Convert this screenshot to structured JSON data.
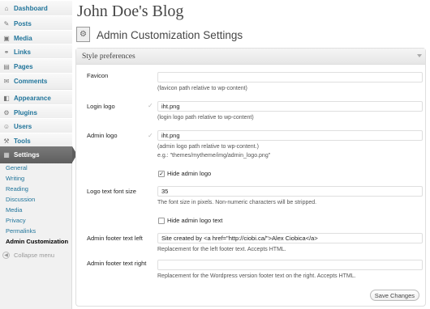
{
  "sidebar": {
    "items": [
      {
        "label": "Dashboard",
        "icon": "dashboard-icon",
        "glyph": "⌂"
      },
      {
        "label": "Posts",
        "icon": "posts-icon",
        "glyph": "✎"
      },
      {
        "label": "Media",
        "icon": "media-icon",
        "glyph": "▣"
      },
      {
        "label": "Links",
        "icon": "links-icon",
        "glyph": "⚭"
      },
      {
        "label": "Pages",
        "icon": "pages-icon",
        "glyph": "▤"
      },
      {
        "label": "Comments",
        "icon": "comments-icon",
        "glyph": "✉"
      },
      {
        "label": "Appearance",
        "icon": "appearance-icon",
        "glyph": "◧"
      },
      {
        "label": "Plugins",
        "icon": "plugins-icon",
        "glyph": "⚙"
      },
      {
        "label": "Users",
        "icon": "users-icon",
        "glyph": "☺"
      },
      {
        "label": "Tools",
        "icon": "tools-icon",
        "glyph": "⚒"
      },
      {
        "label": "Settings",
        "icon": "settings-icon",
        "glyph": "▦"
      }
    ],
    "submenu": [
      "General",
      "Writing",
      "Reading",
      "Discussion",
      "Media",
      "Privacy",
      "Permalinks",
      "Admin Customization"
    ],
    "collapse_label": "Collapse menu"
  },
  "header": {
    "blog_title": "John Doe's Blog",
    "page_title": "Admin Customization Settings"
  },
  "panel": {
    "title": "Style preferences",
    "favicon": {
      "label": "Favicon",
      "value": "",
      "hint": "(favicon path relative to wp-content)"
    },
    "login_logo": {
      "label": "Login logo",
      "value": "iht.png",
      "hint": "(login logo path relative to wp-content)"
    },
    "admin_logo": {
      "label": "Admin logo",
      "value": "iht.png",
      "hint1": "(admin logo path relative to wp-content.)",
      "hint2": "e.g.: \"themes/mytheme/img/admin_logo.png\""
    },
    "hide_admin_logo": {
      "label": "Hide admin logo",
      "checked": true
    },
    "logo_text_font_size": {
      "label": "Logo text font size",
      "value": "35",
      "hint": "The font size in pixels. Non-numeric characters will be stripped."
    },
    "hide_admin_logo_text": {
      "label": "Hide admin logo text",
      "checked": false
    },
    "footer_left": {
      "label": "Admin footer text left",
      "value": "Site created by <a href=\"http://ciobi.ca/\">Alex Ciobica</a>",
      "hint": "Replacement for the left footer text. Accepts HTML."
    },
    "footer_right": {
      "label": "Admin footer text right",
      "value": "",
      "hint": "Replacement for the Wordpress version footer text on the right. Accepts HTML."
    },
    "save_label": "Save Changes"
  },
  "colors": {
    "link": "#21759b",
    "active_menu": "#6b6b6b"
  }
}
